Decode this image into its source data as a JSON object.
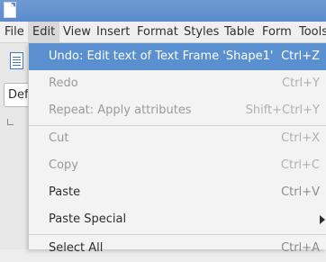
{
  "menubar": {
    "items": [
      "File",
      "Edit",
      "View",
      "Insert",
      "Format",
      "Styles",
      "Table",
      "Form",
      "Tools"
    ],
    "active_item": "Edit"
  },
  "toolbar": {
    "style_box_value": "Def"
  },
  "edit_menu": {
    "items": [
      {
        "label": "Undo: Edit text of Text Frame 'Shape1'",
        "shortcut": "Ctrl+Z",
        "state": "highlighted"
      },
      {
        "label": "Redo",
        "shortcut": "Ctrl+Y",
        "state": "disabled"
      },
      {
        "label": "Repeat: Apply attributes",
        "shortcut": "Shift+Ctrl+Y",
        "state": "disabled"
      },
      {
        "label": "Cut",
        "shortcut": "Ctrl+X",
        "state": "disabled"
      },
      {
        "label": "Copy",
        "shortcut": "Ctrl+C",
        "state": "disabled"
      },
      {
        "label": "Paste",
        "shortcut": "Ctrl+V",
        "state": "enabled"
      },
      {
        "label": "Paste Special",
        "shortcut": "",
        "state": "enabled",
        "submenu": true
      },
      {
        "label": "Select All",
        "shortcut": "Ctrl+A",
        "state": "enabled"
      }
    ]
  },
  "colors": {
    "highlight": "#5a8fd0",
    "titlebar": "#5b8bcc",
    "menu_background": "#f3f3f3",
    "disabled_text": "#9a9a9a"
  },
  "icons": {
    "submenu_arrow": "triangle-right-icon",
    "document": "document-icon"
  }
}
